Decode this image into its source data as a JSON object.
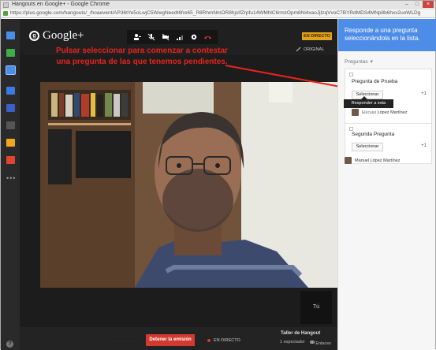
{
  "window": {
    "title": "Hangouts en Google+ - Google Chrome",
    "controls": [
      "–",
      "□",
      "×"
    ]
  },
  "address": {
    "url": "https://plus.google.com/hangouts/_/hoaevent/AP36tYe5oLwjC5WwgNeedt6fre65_R8RhmNmOR8hjsIfZrpfu14WMhlC6rmzOpm8Ni4xaoJjIzqVvoC7BYRdMDS4MNp8b6hxx2uoWLDgXJnsiJ4f4qPcC4Pd1xVCa8SCKmCxfmbz0nmoWJnWGEgCk1HZq8pleNcYaVWWDbjQw"
  },
  "rail": {
    "apps": [
      {
        "icon": "chat-icon",
        "color": "#4a8fe7"
      },
      {
        "icon": "screenshare-icon",
        "color": "#3fae48"
      },
      {
        "icon": "qa-icon",
        "color": "#4a8fe7"
      },
      {
        "icon": "youtube-icon",
        "color": "#3a7be0"
      },
      {
        "icon": "apps-icon",
        "color": "#3a60c7"
      },
      {
        "icon": "photo-icon",
        "color": "#555555"
      },
      {
        "icon": "drive-icon",
        "color": "#f2a81c"
      },
      {
        "icon": "record-icon",
        "color": "#e1452f"
      }
    ],
    "more": "•••",
    "help": "?"
  },
  "topbar": {
    "brand": "Google+",
    "live_badge": "EN DIRECTO",
    "original_label": "ORIGINAL",
    "tools": [
      "person-add-icon",
      "mic-off-icon",
      "camera-off-icon",
      "signal-icon",
      "settings-icon",
      "hangup-icon"
    ]
  },
  "annotation": {
    "text": "Pulsar seleccionar para comenzar a contestar una pregunta de las que tenemos pendientes."
  },
  "video": {
    "thumbnail_label": "Tú"
  },
  "bottombar": {
    "placeholder": "· · · · · · ·",
    "stop_button": "Detener la emisión",
    "live_status": "EN DIRECTO",
    "brand": "Taller de Hangout",
    "viewers": "1 espectador",
    "links": "Enlaces"
  },
  "panel": {
    "header": "Responde a una pregunta seleccionándola en la lista.",
    "tab": "Preguntas",
    "tooltip": "Responder a esta pregunta",
    "questions": [
      {
        "text": "Pregunta de Prueba",
        "select_label": "Seleccionar",
        "votes": "+1",
        "author": "Manuel López Martínez"
      },
      {
        "text": "Segunda Pregunta",
        "select_label": "Seleccionar",
        "votes": "+1",
        "author": "Manuel López Martínez"
      }
    ]
  }
}
